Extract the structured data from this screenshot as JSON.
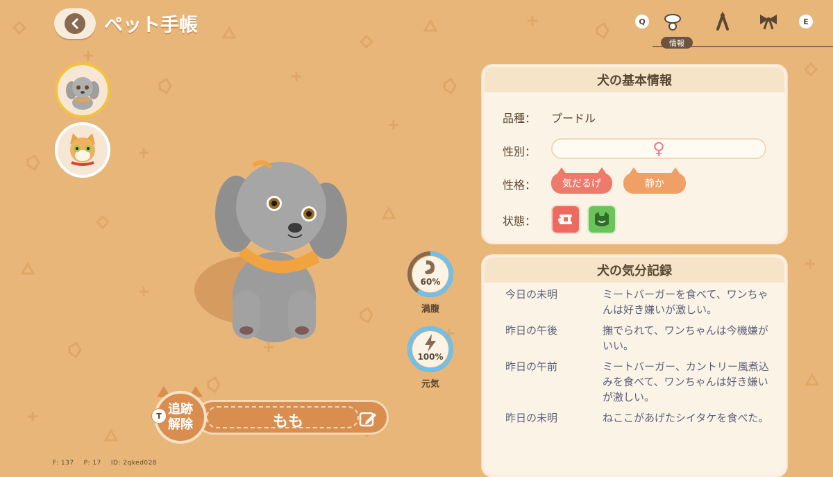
{
  "header": {
    "title": "ペット手帳",
    "key_q": "Q",
    "key_e": "E",
    "active_tab_label": "情報",
    "tab_icons": [
      "collar-icon",
      "bone-icon",
      "bow-icon"
    ]
  },
  "pets": [
    {
      "kind": "dog",
      "selected": true,
      "icon": "poodle-avatar"
    },
    {
      "kind": "cat",
      "selected": false,
      "icon": "cat-avatar"
    }
  ],
  "gauges": {
    "fullness": {
      "label": "満腹",
      "value_text": "60%",
      "value": 0.6,
      "icon": "stomach-icon",
      "color": "#6ec0ee"
    },
    "energy": {
      "label": "元気",
      "value_text": "100%",
      "value": 1.0,
      "icon": "lightning-icon",
      "color": "#6ec0ee"
    }
  },
  "pet_name": "もも",
  "track_button": {
    "key": "T",
    "line1": "追跡",
    "line2": "解除"
  },
  "debug": {
    "f": "F: 137",
    "p": "P: 17",
    "id": "ID: 2qked028"
  },
  "basic_info": {
    "title": "犬の基本情報",
    "breed_label": "品種：",
    "breed_value": "プードル",
    "gender_label": "性別：",
    "gender_symbol": "♀",
    "personality_label": "性格：",
    "traits": [
      {
        "label": "気だるげ",
        "color": "#ec7b6c"
      },
      {
        "label": "静か",
        "color": "#f0a064"
      }
    ],
    "status_label": "状態：",
    "status_icons": [
      {
        "name": "food-dislike-icon",
        "color": "#ec6a60"
      },
      {
        "name": "happy-face-icon",
        "color": "#6cc35a"
      }
    ]
  },
  "mood_log": {
    "title": "犬の気分記録",
    "entries": [
      {
        "time": "今日の未明",
        "text": "ミートバーガーを食べて、ワンちゃんは好き嫌いが激しい。"
      },
      {
        "time": "昨日の午後",
        "text": "撫でられて、ワンちゃんは今機嫌がいい。"
      },
      {
        "time": "昨日の午前",
        "text": "ミートバーガー、カントリー風煮込みを食べて、ワンちゃんは好き嫌いが激しい。"
      },
      {
        "time": "昨日の未明",
        "text": "ねここがあげたシイタケを食べた。"
      }
    ]
  }
}
